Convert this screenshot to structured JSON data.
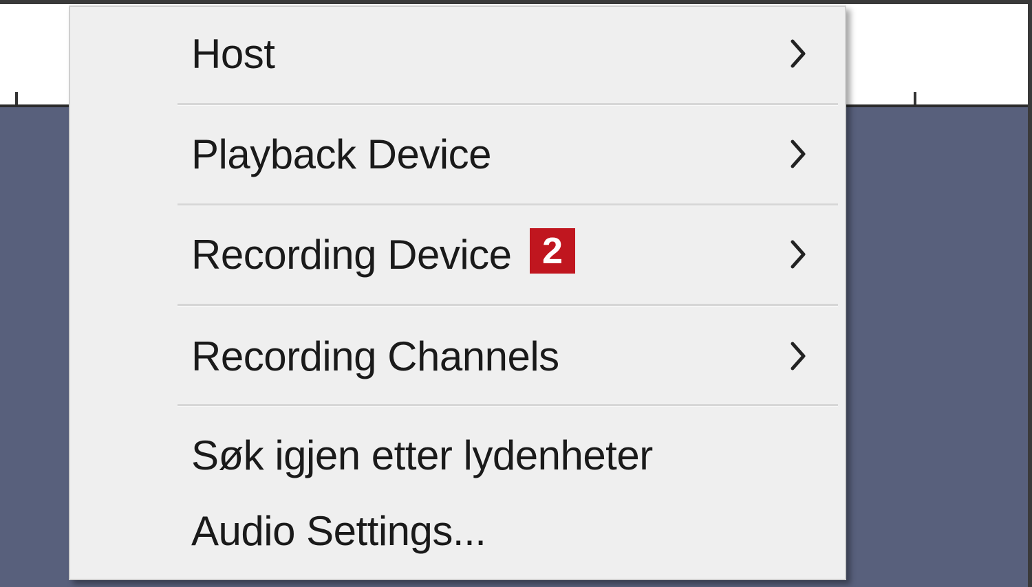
{
  "menu": {
    "items": [
      {
        "label": "Host",
        "has_submenu": true
      },
      {
        "label": "Playback Device",
        "has_submenu": true
      },
      {
        "label": "Recording Device",
        "has_submenu": true,
        "badge": "2"
      },
      {
        "label": "Recording Channels",
        "has_submenu": true
      },
      {
        "label": "Søk igjen etter lydenheter",
        "has_submenu": false
      },
      {
        "label": "Audio Settings...",
        "has_submenu": false
      }
    ]
  },
  "icons": {
    "submenu_arrow": "chevron-right-icon"
  },
  "colors": {
    "menu_background": "#efefef",
    "workspace_background": "#58607c",
    "badge_background": "#c0161f",
    "badge_text": "#ffffff"
  }
}
